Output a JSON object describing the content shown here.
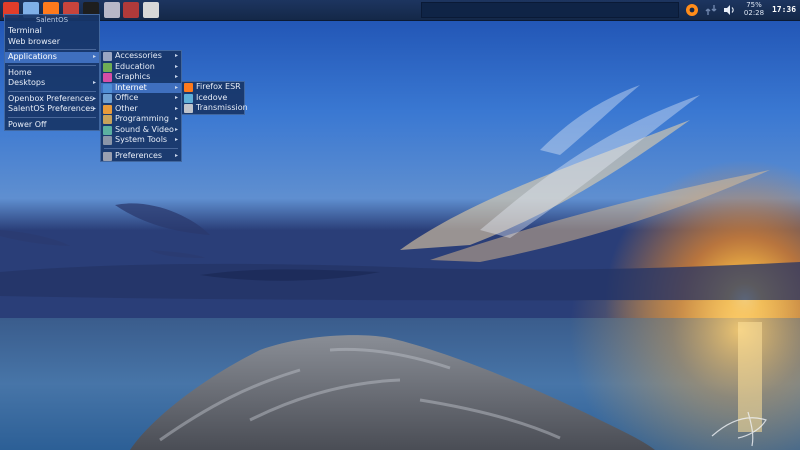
{
  "panel": {
    "launchers": [
      {
        "name": "menu-logo-icon",
        "color": "#e23d2a"
      },
      {
        "name": "files-icon",
        "color": "#7fb0e8"
      },
      {
        "name": "firefox-icon",
        "color": "#ff7a1c"
      },
      {
        "name": "image-viewer-icon",
        "color": "#c8443c"
      },
      {
        "name": "terminal-icon",
        "color": "#1e1e1e"
      },
      {
        "name": "system-monitor-icon",
        "color": "#b8b8c8"
      },
      {
        "name": "package-icon",
        "color": "#b03a3a"
      },
      {
        "name": "power-icon",
        "color": "#d8d8d8"
      }
    ],
    "battery_percent": "75%",
    "battery_time": "02:28",
    "clock": "17:36"
  },
  "root_menu": {
    "title": "SalentOS",
    "items": [
      {
        "label": "Terminal",
        "name": "menu-item-terminal"
      },
      {
        "label": "Web browser",
        "name": "menu-item-web-browser"
      },
      {
        "sep": true
      },
      {
        "label": "Applications",
        "name": "menu-item-applications",
        "arrow": true,
        "selected": true
      },
      {
        "sep": true
      },
      {
        "label": "Home",
        "name": "menu-item-home"
      },
      {
        "label": "Desktops",
        "name": "menu-item-desktops",
        "arrow": true
      },
      {
        "sep": true
      },
      {
        "label": "Openbox Preferences",
        "name": "menu-item-openbox-preferences",
        "arrow": true
      },
      {
        "label": "SalentOS Preferences",
        "name": "menu-item-salentos-preferences",
        "arrow": true
      },
      {
        "sep": true
      },
      {
        "label": "Power Off",
        "name": "menu-item-power-off"
      }
    ]
  },
  "apps_menu": {
    "items": [
      {
        "label": "Accessories",
        "name": "menu-item-accessories",
        "icon_color": "#9aa6c2",
        "arrow": true
      },
      {
        "label": "Education",
        "name": "menu-item-education",
        "icon_color": "#6fae55",
        "arrow": true
      },
      {
        "label": "Graphics",
        "name": "menu-item-graphics",
        "icon_color": "#d64fa6",
        "arrow": true
      },
      {
        "label": "Internet",
        "name": "menu-item-internet",
        "icon_color": "#4f8ed6",
        "arrow": true,
        "selected": true
      },
      {
        "label": "Office",
        "name": "menu-item-office",
        "icon_color": "#6e9ed0",
        "arrow": true
      },
      {
        "label": "Other",
        "name": "menu-item-other",
        "icon_color": "#e89a3a",
        "arrow": true
      },
      {
        "label": "Programming",
        "name": "menu-item-programming",
        "icon_color": "#c7a25b",
        "arrow": true
      },
      {
        "label": "Sound & Video",
        "name": "menu-item-sound-video",
        "icon_color": "#5bb0a0",
        "arrow": true
      },
      {
        "label": "System Tools",
        "name": "menu-item-system-tools",
        "icon_color": "#8a95a8",
        "arrow": true
      },
      {
        "sep": true
      },
      {
        "label": "Preferences",
        "name": "menu-item-preferences",
        "icon_color": "#9aa0b0",
        "arrow": true
      }
    ]
  },
  "internet_menu": {
    "items": [
      {
        "label": "Firefox ESR",
        "name": "menu-item-firefox-esr",
        "icon_color": "#ff7a1c"
      },
      {
        "label": "Icedove",
        "name": "menu-item-icedove",
        "icon_color": "#5fb0d8"
      },
      {
        "label": "Transmission",
        "name": "menu-item-transmission",
        "icon_color": "#c0c4cc"
      }
    ]
  }
}
